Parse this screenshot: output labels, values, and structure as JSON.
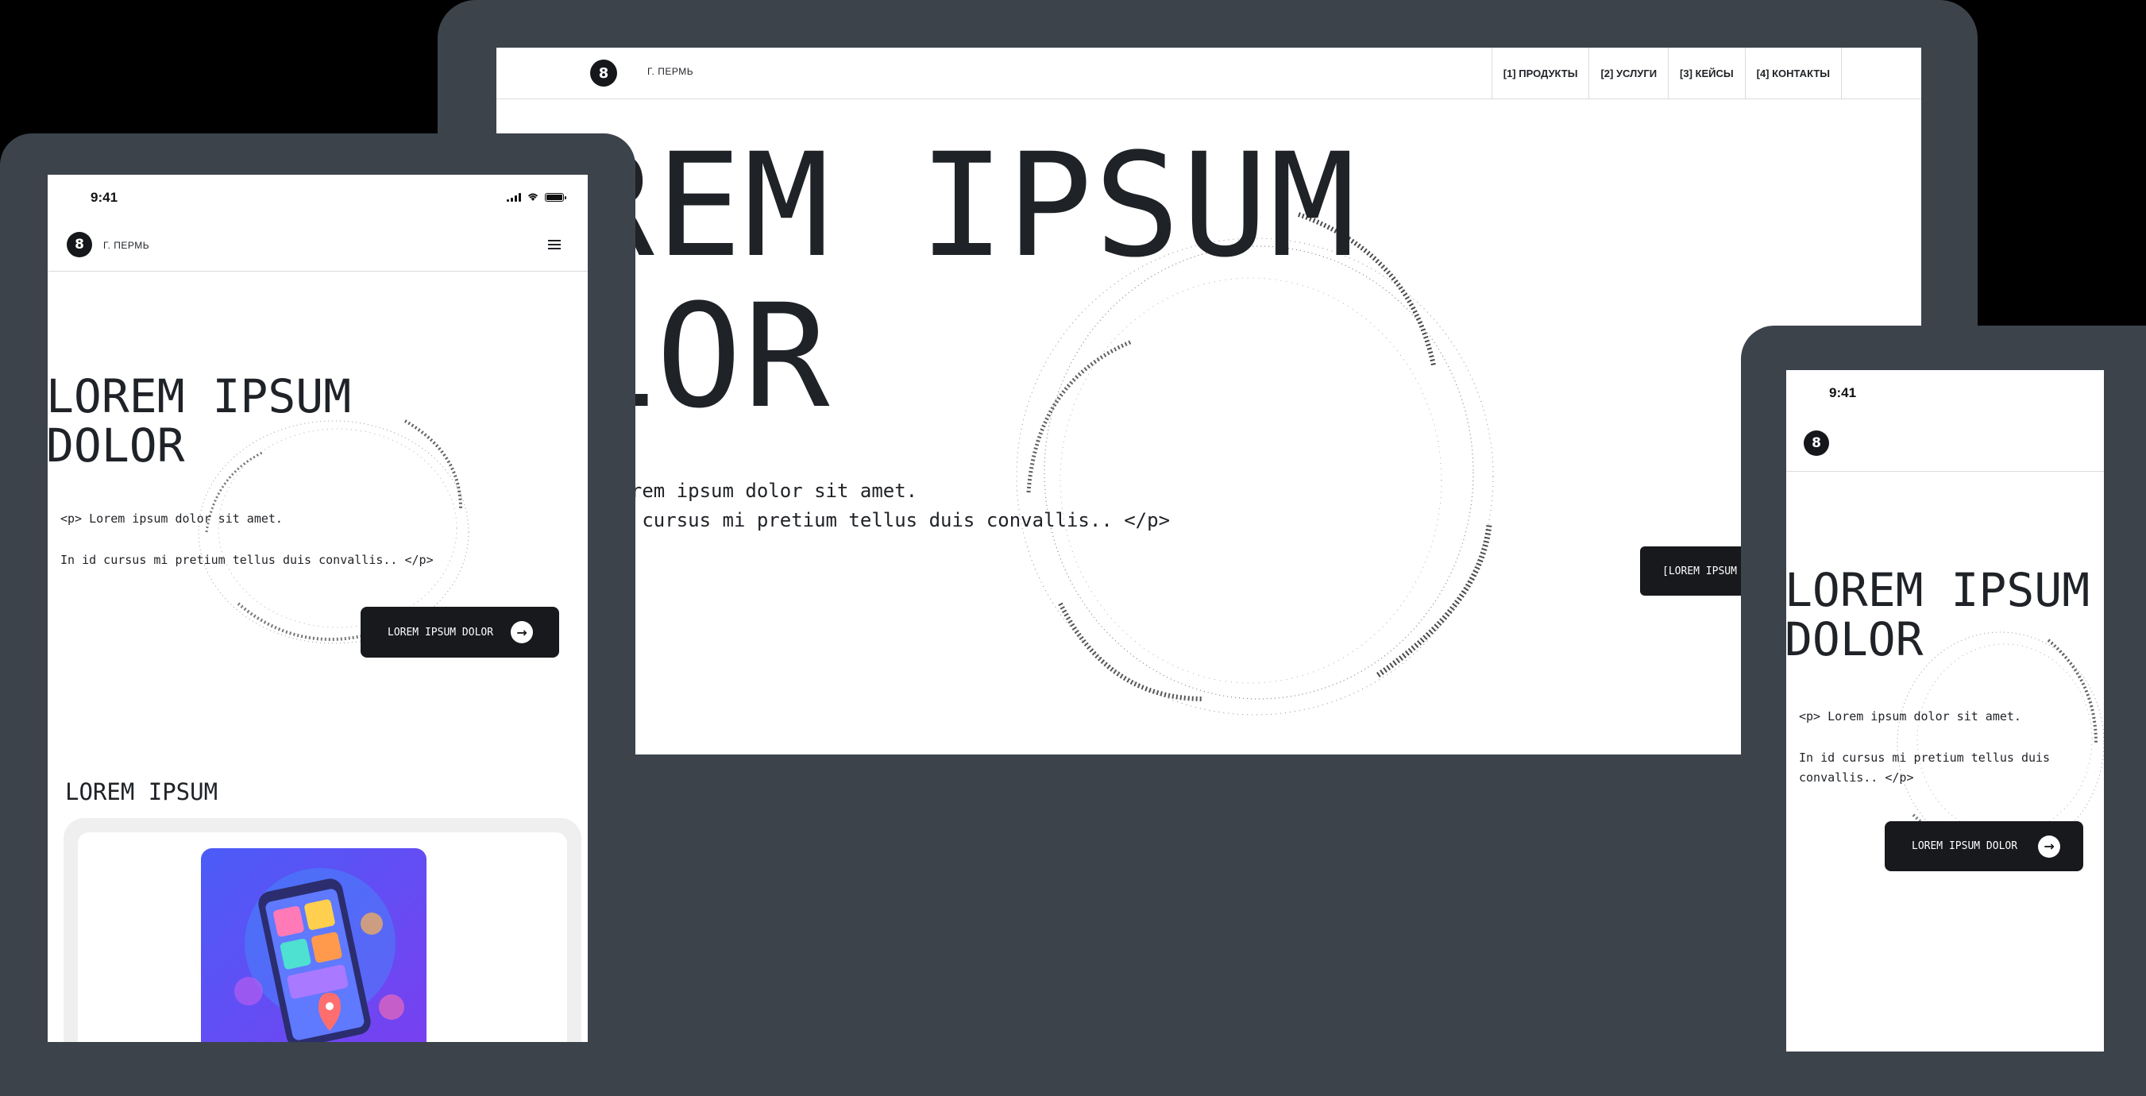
{
  "desktop": {
    "header": {
      "city": "Г. ПЕРМЬ",
      "logo_glyph": "8"
    },
    "nav": [
      {
        "label": "[1] ПРОДУКТЫ"
      },
      {
        "label": "[2] УСЛУГИ"
      },
      {
        "label": "[3] КЕЙСЫ"
      },
      {
        "label": "[4] КОНТАКТЫ"
      }
    ],
    "hero": {
      "line1": "OREM IPSUM",
      "line2": "OLOR",
      "para_line1": "Lorem ipsum dolor sit amet.",
      "para_line2": "id cursus mi pretium tellus duis convallis.. </p>",
      "cta_label": "[LOREM IPSUM D"
    }
  },
  "tablet": {
    "status": {
      "time": "9:41"
    },
    "header": {
      "city": "Г. ПЕРМЬ",
      "logo_glyph": "8",
      "menu_icon": "hamburger-icon"
    },
    "hero": {
      "line1": "LOREM IPSUM",
      "line2": "DOLOR",
      "para_line1": "<p> Lorem ipsum dolor sit amet.",
      "para_line2": "In id cursus mi pretium tellus duis convallis.. </p>",
      "cta_label": "LOREM IPSUM DOLOR",
      "cta_icon": "arrow-right-icon"
    },
    "section": {
      "title": "LOREM IPSUM"
    }
  },
  "phone": {
    "status": {
      "time": "9:41"
    },
    "header": {
      "logo_glyph": "8"
    },
    "hero": {
      "line1": "LOREM IPSUM",
      "line2": "DOLOR",
      "para_line1": "<p> Lorem ipsum dolor sit amet.",
      "para_line2": "In id cursus mi pretium tellus duis convallis.. </p>",
      "cta_label": "LOREM IPSUM DOLOR",
      "cta_icon": "arrow-right-icon"
    }
  },
  "colors": {
    "frame": "#3c434b",
    "screen": "#ffffff",
    "text": "#1f2227",
    "button": "#17191c",
    "divider": "#d9dbde",
    "card_bg": "#efeff0",
    "illustration": "#5b4ef5"
  }
}
